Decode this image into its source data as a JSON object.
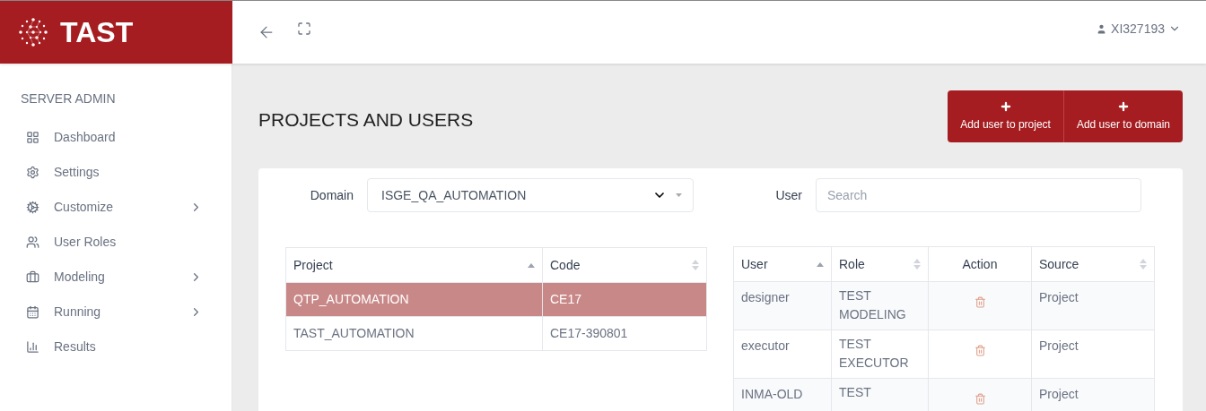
{
  "brand": {
    "name": "TAST"
  },
  "user_menu": {
    "username": "XI327193"
  },
  "sidebar": {
    "section": "SERVER ADMIN",
    "items": [
      {
        "label": "Dashboard",
        "has_submenu": false
      },
      {
        "label": "Settings",
        "has_submenu": false
      },
      {
        "label": "Customize",
        "has_submenu": true
      },
      {
        "label": "User Roles",
        "has_submenu": false
      },
      {
        "label": "Modeling",
        "has_submenu": true
      },
      {
        "label": "Running",
        "has_submenu": true
      },
      {
        "label": "Results",
        "has_submenu": false
      }
    ]
  },
  "page": {
    "title": "PROJECTS AND USERS",
    "buttons": [
      {
        "label": "Add user to project"
      },
      {
        "label": "Add user to domain"
      }
    ]
  },
  "filters": {
    "domain_label": "Domain",
    "domain_value": "ISGE_QA_AUTOMATION",
    "user_label": "User",
    "user_placeholder": "Search"
  },
  "projects_table": {
    "columns": [
      {
        "label": "Project",
        "kind": "sorted"
      },
      {
        "label": "Code",
        "kind": "sortable"
      }
    ],
    "rows": [
      {
        "cells": [
          "QTP_AUTOMATION",
          "CE17"
        ],
        "selected": true
      },
      {
        "cells": [
          "TAST_AUTOMATION",
          "CE17-390801"
        ],
        "selected": false
      }
    ]
  },
  "users_table": {
    "columns": [
      {
        "label": "User",
        "kind": "sorted"
      },
      {
        "label": "Role",
        "kind": "sortable"
      },
      {
        "label": "Action",
        "kind": "plain"
      },
      {
        "label": "Source",
        "kind": "sortable"
      }
    ],
    "rows": [
      {
        "user": "designer",
        "role": "TEST MODELING",
        "source": "Project"
      },
      {
        "user": "executor",
        "role": "TEST EXECUTOR",
        "source": "Project"
      },
      {
        "user": "INMA-OLD",
        "role": "TEST",
        "source": "Project"
      }
    ]
  }
}
